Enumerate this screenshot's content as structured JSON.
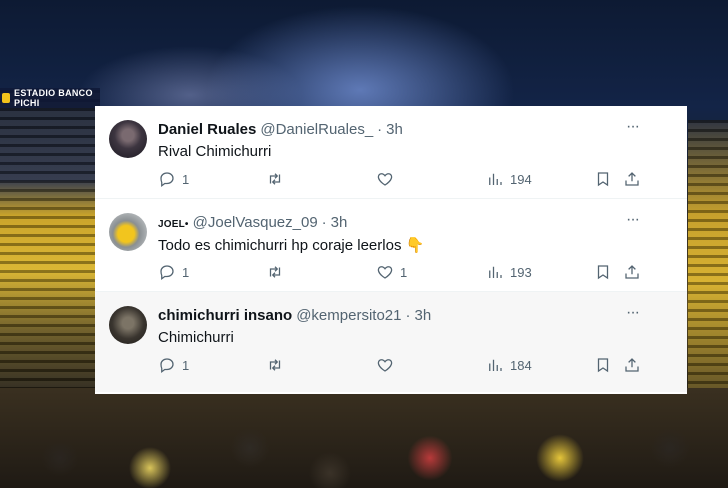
{
  "background": {
    "sign_text": "ESTADIO BANCO PICHI"
  },
  "tweets": [
    {
      "name": "Daniel Ruales",
      "handle": "@DanielRuales_",
      "sep": "·",
      "time": "3h",
      "text": "Rival Chimichurri",
      "more": "···",
      "reply_count": "1",
      "retweet_count": "",
      "like_count": "",
      "views": "194"
    },
    {
      "name": "JOEL",
      "handle": "@JoelVasquez_09",
      "sep": "·",
      "time": "3h",
      "text": "Todo es chimichurri  hp coraje leerlos 👇",
      "more": "···",
      "reply_count": "1",
      "retweet_count": "",
      "like_count": "1",
      "views": "193"
    },
    {
      "name": "chimichurri insano",
      "handle": "@kempersito21",
      "sep": "·",
      "time": "3h",
      "text": "Chimichurri",
      "more": "···",
      "reply_count": "1",
      "retweet_count": "",
      "like_count": "",
      "views": "184"
    }
  ],
  "icons": {
    "reply": "reply-icon",
    "retweet": "retweet-icon",
    "like": "heart-icon",
    "views": "views-icon",
    "bookmark": "bookmark-icon",
    "share": "share-icon"
  }
}
